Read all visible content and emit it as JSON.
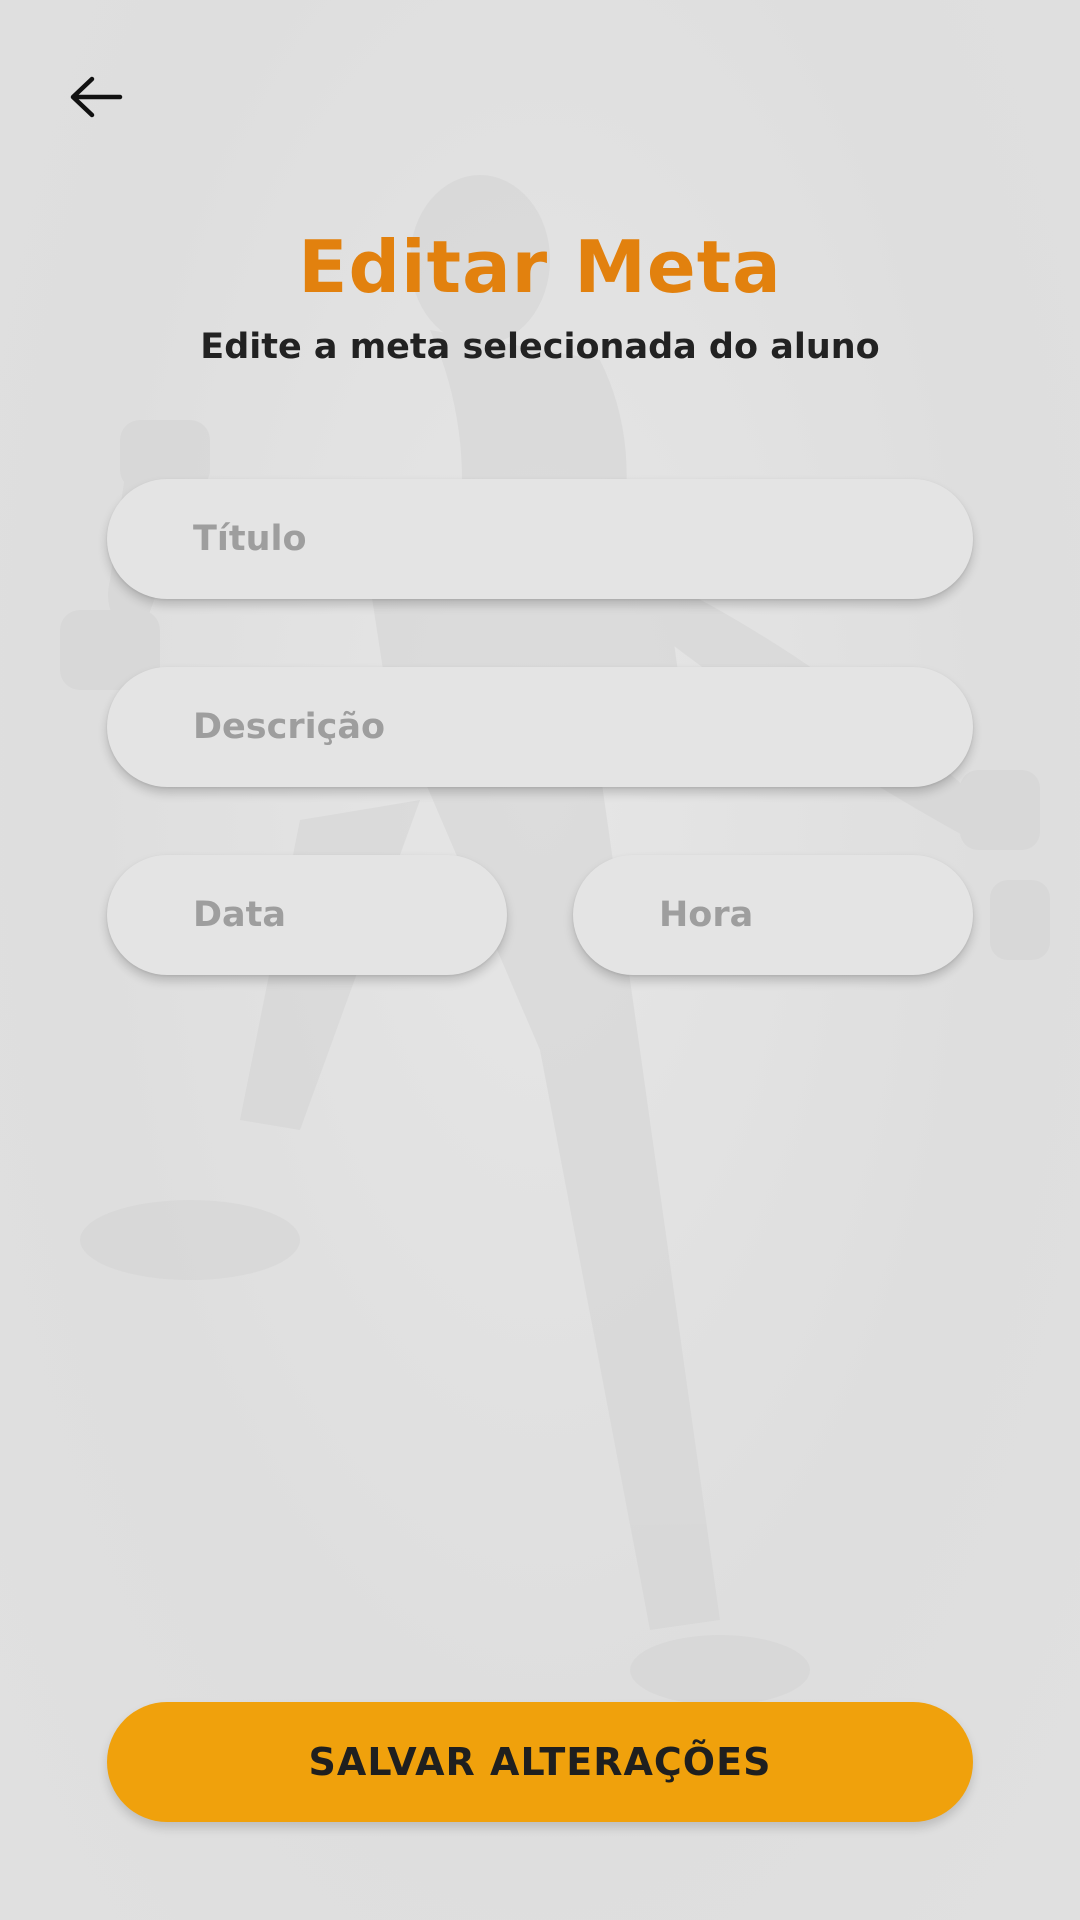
{
  "screen": {
    "title": "Editar Meta",
    "subtitle": "Edite a meta selecionada do aluno"
  },
  "header": {
    "back_icon": "arrow-left-icon"
  },
  "form": {
    "titulo_placeholder": "Título",
    "titulo_value": "",
    "descricao_placeholder": "Descrição",
    "descricao_value": "",
    "data_placeholder": "Data",
    "data_value": "",
    "hora_placeholder": "Hora",
    "hora_value": ""
  },
  "actions": {
    "save_label": "SALVAR ALTERAÇÕES"
  },
  "colors": {
    "accent_title": "#e2810e",
    "button": "#f0a10c",
    "background": "#e2e2e2"
  }
}
